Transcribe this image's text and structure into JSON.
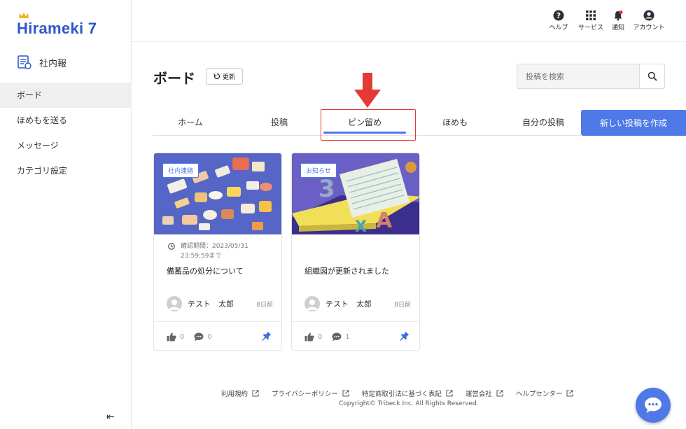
{
  "app": {
    "logo_text": "irameki 7",
    "section_label": "社内報"
  },
  "sidebar": {
    "items": [
      {
        "label": "ボード"
      },
      {
        "label": "ほめもを送る"
      },
      {
        "label": "メッセージ"
      },
      {
        "label": "カテゴリ設定"
      }
    ],
    "collapse_glyph": "⇤"
  },
  "topbar": {
    "help": "ヘルプ",
    "services": "サービス",
    "notifications": "通知",
    "account": "アカウント"
  },
  "header": {
    "title": "ボード",
    "refresh_label": "更新",
    "search_placeholder": "投稿を検索"
  },
  "tabs": [
    {
      "label": "ホーム"
    },
    {
      "label": "投稿"
    },
    {
      "label": "ピン留め"
    },
    {
      "label": "ほめも"
    },
    {
      "label": "自分の投稿"
    }
  ],
  "new_post_label": "新しい投稿を作成",
  "cards": [
    {
      "badge": "社内連絡",
      "deadline": "確認期間：2023/05/31 23:59:59まで",
      "title": "備蓄品の処分について",
      "author": "テスト　太郎",
      "ago": "8日前",
      "likes": "0",
      "comments": "0"
    },
    {
      "badge": "お知らせ",
      "deadline": "",
      "title": "組織図が更新されました",
      "author": "テスト　太郎",
      "ago": "8日前",
      "likes": "0",
      "comments": "1"
    }
  ],
  "footer": {
    "links": [
      "利用規約",
      "プライバシーポリシー",
      "特定商取引法に基づく表記",
      "運営会社",
      "ヘルプセンター"
    ],
    "copyright": "Copyright© Tribeck Inc. All Rights Reserved."
  },
  "colors": {
    "accent": "#4e79e6",
    "highlight": "#e53935"
  }
}
